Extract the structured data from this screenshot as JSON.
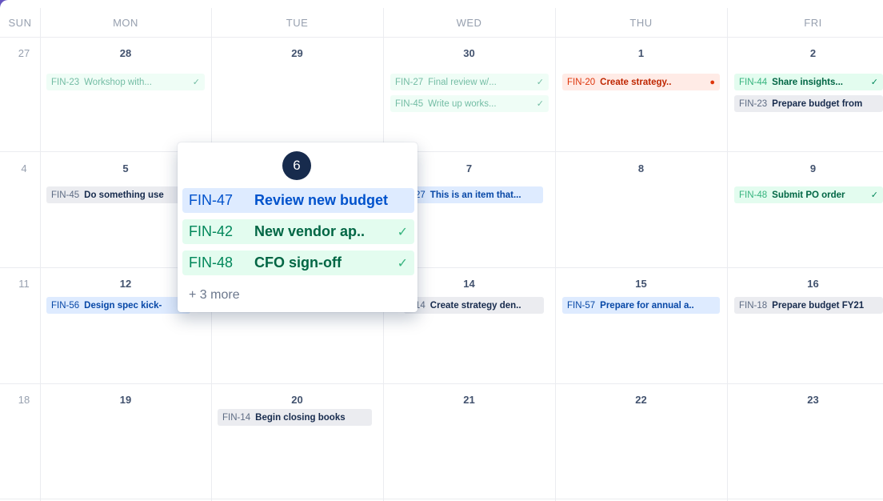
{
  "weekdays": [
    "SUN",
    "MON",
    "TUE",
    "WED",
    "THU",
    "FRI"
  ],
  "weeks": [
    [
      "27",
      "28",
      "29",
      "30",
      "1",
      "2"
    ],
    [
      "4",
      "5",
      "",
      "7",
      "8",
      "9"
    ],
    [
      "11",
      "12",
      "",
      "14",
      "15",
      "16"
    ],
    [
      "18",
      "19",
      "20",
      "21",
      "22",
      "23"
    ]
  ],
  "events": {
    "w1_mon": {
      "key": "FIN-23",
      "title": "Workshop with...",
      "icon": "✓"
    },
    "w1_wed_a": {
      "key": "FIN-27",
      "title": "Final review w/...",
      "icon": "✓"
    },
    "w1_wed_b": {
      "key": "FIN-45",
      "title": "Write up works...",
      "icon": "✓"
    },
    "w1_thu": {
      "key": "FIN-20",
      "title": "Create strategy..",
      "icon": "●"
    },
    "w1_fri_a": {
      "key": "FIN-44",
      "title": "Share insights...",
      "icon": "✓"
    },
    "w1_fri_b": {
      "key": "FIN-23",
      "title": "Prepare budget from"
    },
    "w2_mon": {
      "key": "FIN-45",
      "title": "Do something use"
    },
    "w2_wed": {
      "key": "27",
      "title": "This is an item that..."
    },
    "w2_fri": {
      "key": "FIN-48",
      "title": "Submit PO order",
      "icon": "✓"
    },
    "w3_mon": {
      "key": "FIN-56",
      "title": "Design spec kick-"
    },
    "w3_wed": {
      "key": "14",
      "title": "Create strategy den.."
    },
    "w3_thu": {
      "key": "FIN-57",
      "title": "Prepare for annual a.."
    },
    "w3_fri": {
      "key": "FIN-18",
      "title": "Prepare budget FY21"
    },
    "w4_tue": {
      "key": "FIN-14",
      "title": "Begin closing books"
    }
  },
  "popup": {
    "day": "6",
    "items": [
      {
        "key": "FIN-47",
        "title": "Review new budget",
        "icon": ""
      },
      {
        "key": "FIN-42",
        "title": "New vendor ap..",
        "icon": "✓"
      },
      {
        "key": "FIN-48",
        "title": "CFO sign-off",
        "icon": "✓"
      }
    ],
    "more": "+ 3 more"
  },
  "colors": {
    "frame": "#6554C0",
    "done_green": "#00875A",
    "overdue_red": "#DE350B",
    "active_blue": "#0052CC",
    "badge_navy": "#172B4D"
  }
}
